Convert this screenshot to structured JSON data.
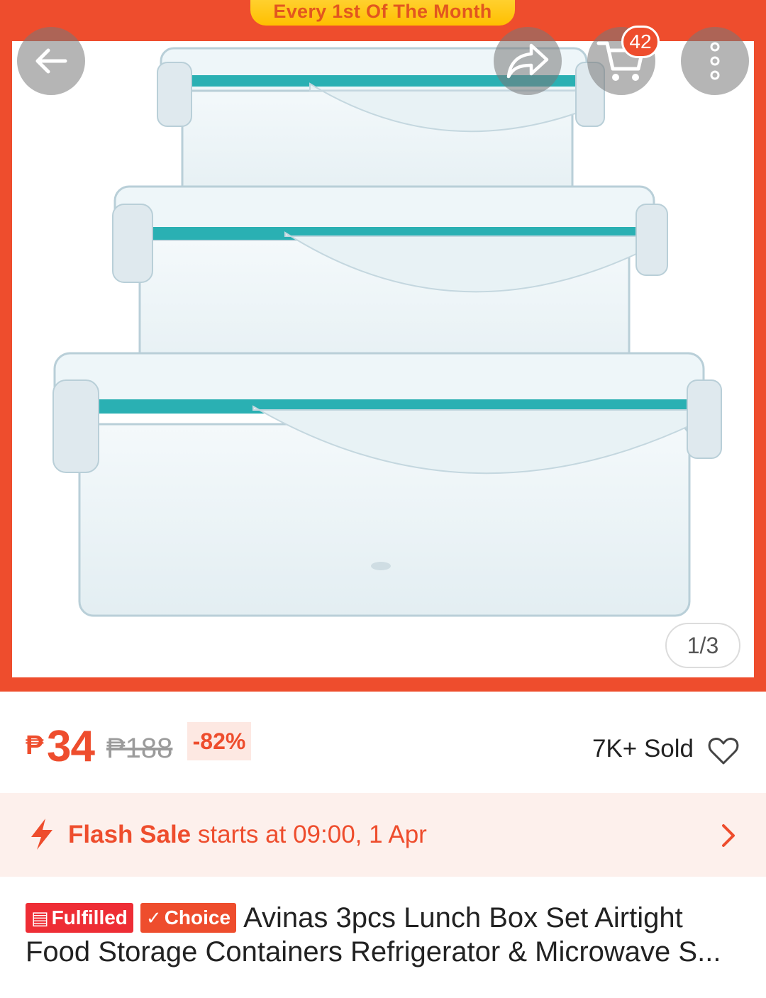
{
  "promo": {
    "banner": "Every 1st Of The Month"
  },
  "nav": {
    "back_icon": "arrow-left-icon",
    "share_icon": "share-icon",
    "cart_icon": "cart-icon",
    "cart_count": "42",
    "more_icon": "more-vertical-icon"
  },
  "gallery": {
    "counter": "1/3"
  },
  "price": {
    "currency_symbol": "₱",
    "current": "34",
    "original": "₱188",
    "discount": "-82%"
  },
  "sales": {
    "sold": "7K+ Sold",
    "favorite_icon": "heart-icon"
  },
  "flash_sale": {
    "label": "Flash Sale",
    "message": " starts at 09:00, 1 Apr",
    "icon": "lightning-icon",
    "chevron_icon": "chevron-right-icon"
  },
  "product": {
    "tags": {
      "fulfilled": "Fulfilled",
      "choice": "Choice"
    },
    "title": "Avinas 3pcs Lunch Box Set Airtight Food Storage Containers Refrigerator & Microwave S..."
  },
  "colors": {
    "brand": "#ee4d2d",
    "flash_bg": "#fdf0ec",
    "promo_yellow": "#ffc400"
  }
}
